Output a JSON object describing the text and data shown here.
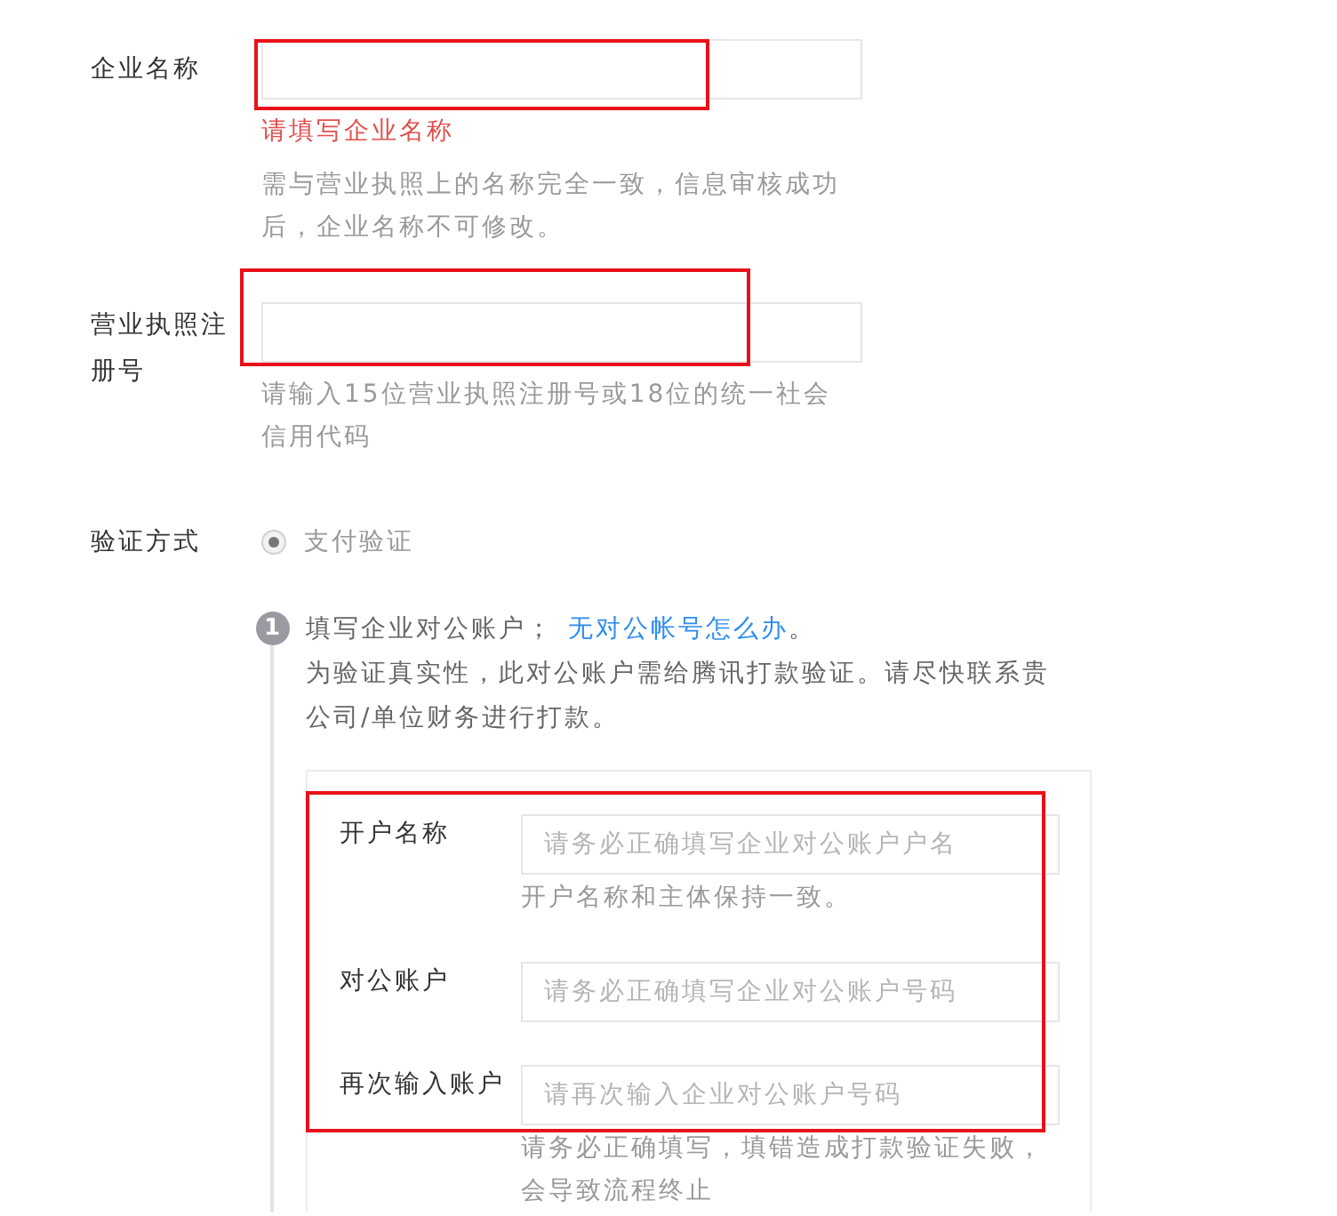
{
  "fields": [
    {
      "kind": "text",
      "label": "企业名称",
      "error": "请填写企业名称",
      "help": "需与营业执照上的名称完全一致，信息审核成功后，企业名称不可修改。",
      "highlighted": true
    },
    {
      "kind": "text",
      "label": "营业执照注册号",
      "help": "请输入15位营业执照注册号或18位的统一社会信用代码",
      "highlighted": true
    },
    {
      "kind": "radio",
      "label": "验证方式",
      "options": [
        {
          "label": "支付验证",
          "selected": true,
          "disabled": true
        }
      ]
    }
  ],
  "step": {
    "number": "1",
    "title": "填写企业对公账户；",
    "link": "无对公帐号怎么办",
    "link_suffix": "。",
    "description": "为验证真实性，此对公账户需给腾讯打款验证。请尽快联系贵公司/单位财务进行打款。"
  },
  "account_section": {
    "highlighted": true,
    "fields": [
      {
        "label": "开户名称",
        "placeholder": "请务必正确填写企业对公账户户名",
        "help": "开户名称和主体保持一致。"
      },
      {
        "label": "对公账户",
        "placeholder": "请务必正确填写企业对公账户号码"
      },
      {
        "label": "再次输入账户",
        "placeholder": "请再次输入企业对公账户号码",
        "help": "请务必正确填写，填错造成打款验证失败，会导致流程终止"
      }
    ]
  }
}
